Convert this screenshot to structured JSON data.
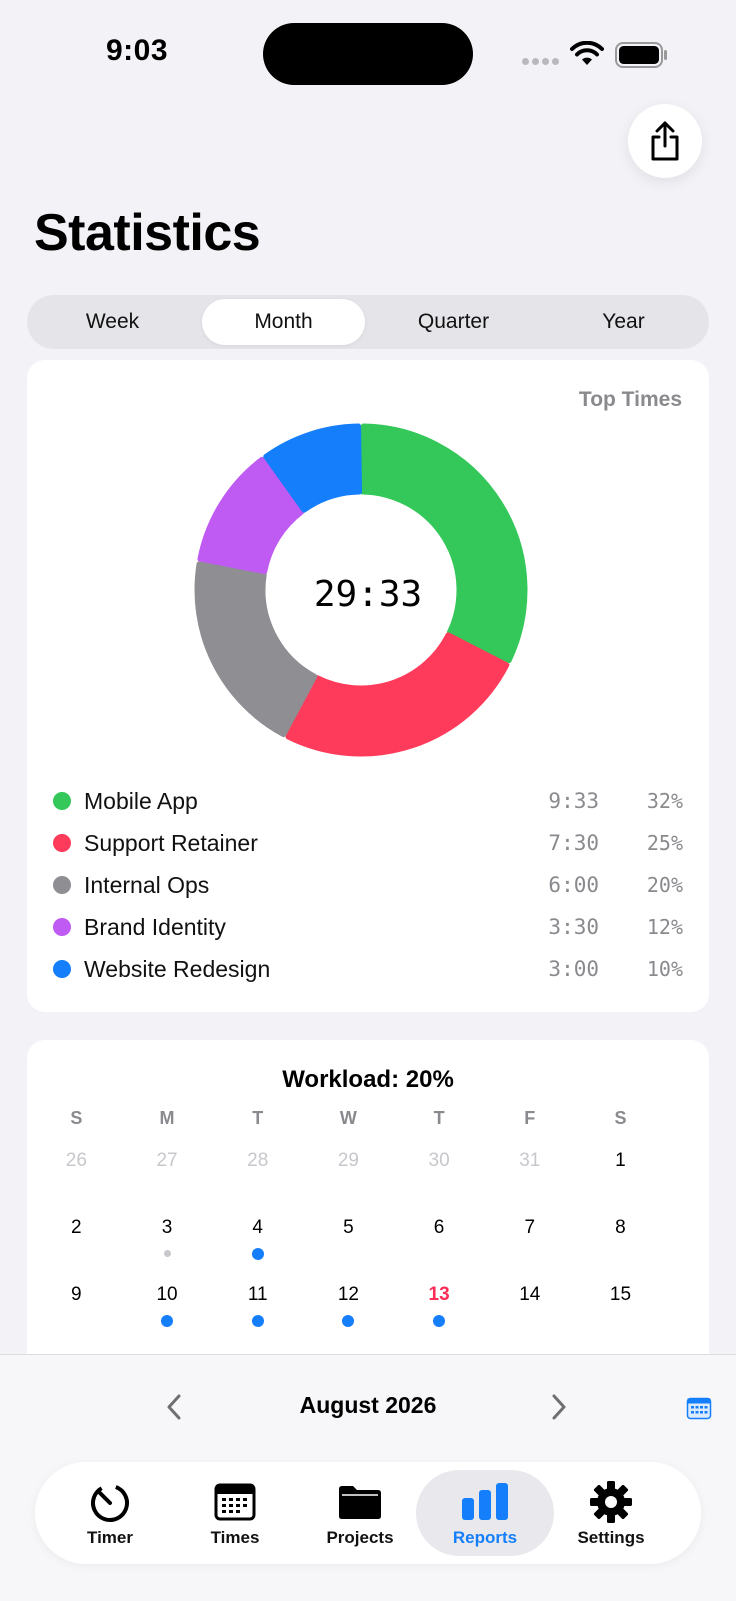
{
  "status": {
    "time": "9:03"
  },
  "page": {
    "title": "Statistics"
  },
  "segments": [
    {
      "label": "Week",
      "active": false
    },
    {
      "label": "Month",
      "active": true
    },
    {
      "label": "Quarter",
      "active": false
    },
    {
      "label": "Year",
      "active": false
    }
  ],
  "chart_data": {
    "type": "pie",
    "title": "Top Times",
    "center_label": "29:33",
    "slices": [
      {
        "name": "Mobile App",
        "time": "9:33",
        "percent": 32,
        "color": "#34c759"
      },
      {
        "name": "Support Retainer",
        "time": "7:30",
        "percent": 25,
        "color": "#ff3b5c"
      },
      {
        "name": "Internal Ops",
        "time": "6:00",
        "percent": 20,
        "color": "#8e8e93"
      },
      {
        "name": "Brand Identity",
        "time": "3:30",
        "percent": 12,
        "color": "#bf5af2"
      },
      {
        "name": "Website Redesign",
        "time": "3:00",
        "percent": 10,
        "color": "#147efb"
      }
    ]
  },
  "legend_pct_labels": [
    "32%",
    "25%",
    "20%",
    "12%",
    "10%"
  ],
  "calendar": {
    "title": "Workload: 20%",
    "weekdays": [
      "S",
      "M",
      "T",
      "W",
      "T",
      "F",
      "S"
    ],
    "weeks": [
      [
        {
          "day": "26",
          "muted": true
        },
        {
          "day": "27",
          "muted": true
        },
        {
          "day": "28",
          "muted": true
        },
        {
          "day": "29",
          "muted": true
        },
        {
          "day": "30",
          "muted": true
        },
        {
          "day": "31",
          "muted": true
        },
        {
          "day": "1"
        }
      ],
      [
        {
          "day": "2"
        },
        {
          "day": "3",
          "dot": "small"
        },
        {
          "day": "4",
          "dot": "blue"
        },
        {
          "day": "5"
        },
        {
          "day": "6"
        },
        {
          "day": "7"
        },
        {
          "day": "8"
        }
      ],
      [
        {
          "day": "9"
        },
        {
          "day": "10",
          "dot": "blue"
        },
        {
          "day": "11",
          "dot": "blue"
        },
        {
          "day": "12",
          "dot": "blue"
        },
        {
          "day": "13",
          "dot": "blue",
          "today": true
        },
        {
          "day": "14"
        },
        {
          "day": "15"
        }
      ]
    ]
  },
  "month_nav": {
    "label": "August 2026"
  },
  "tabs": [
    {
      "label": "Timer",
      "icon": "timer-icon",
      "active": false
    },
    {
      "label": "Times",
      "icon": "calendar-grid-icon",
      "active": false
    },
    {
      "label": "Projects",
      "icon": "folder-icon",
      "active": false
    },
    {
      "label": "Reports",
      "icon": "bar-chart-icon",
      "active": true
    },
    {
      "label": "Settings",
      "icon": "gear-icon",
      "active": false
    }
  ],
  "colors": {
    "accent": "#147efb",
    "today": "#ff2d55"
  }
}
